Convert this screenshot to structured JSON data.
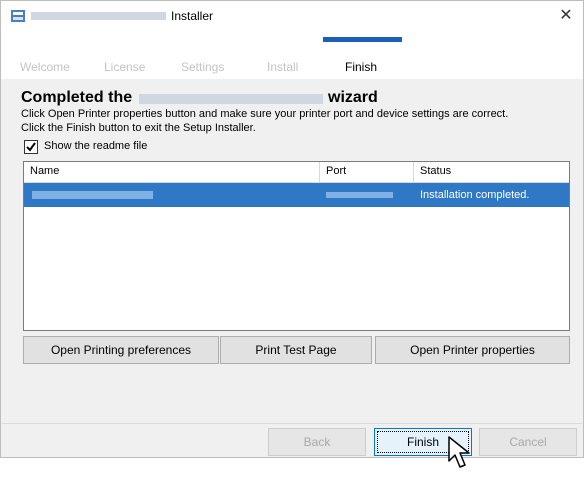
{
  "window": {
    "title": "Installer"
  },
  "steps": [
    "Welcome",
    "License",
    "Settings",
    "Install",
    "Finish"
  ],
  "active_step": "Finish",
  "heading": {
    "prefix": "Completed the",
    "suffix": "wizard"
  },
  "description": {
    "line1": "Click Open Printer properties button and make sure your printer port and device settings are correct.",
    "line2": "Click the Finish button to exit the Setup Installer."
  },
  "readme_checkbox": {
    "label": "Show the readme file",
    "checked": true
  },
  "table": {
    "columns": [
      "Name",
      "Port",
      "Status"
    ],
    "rows": [
      {
        "status": "Installation completed."
      }
    ]
  },
  "actions": {
    "open_printing_preferences": "Open Printing preferences",
    "print_test_page": "Print Test Page",
    "open_printer_properties": "Open Printer properties"
  },
  "footer": {
    "back": "Back",
    "finish": "Finish",
    "cancel": "Cancel"
  },
  "colors": {
    "accent": "#1c5fb8",
    "selection": "#2f78c6"
  }
}
